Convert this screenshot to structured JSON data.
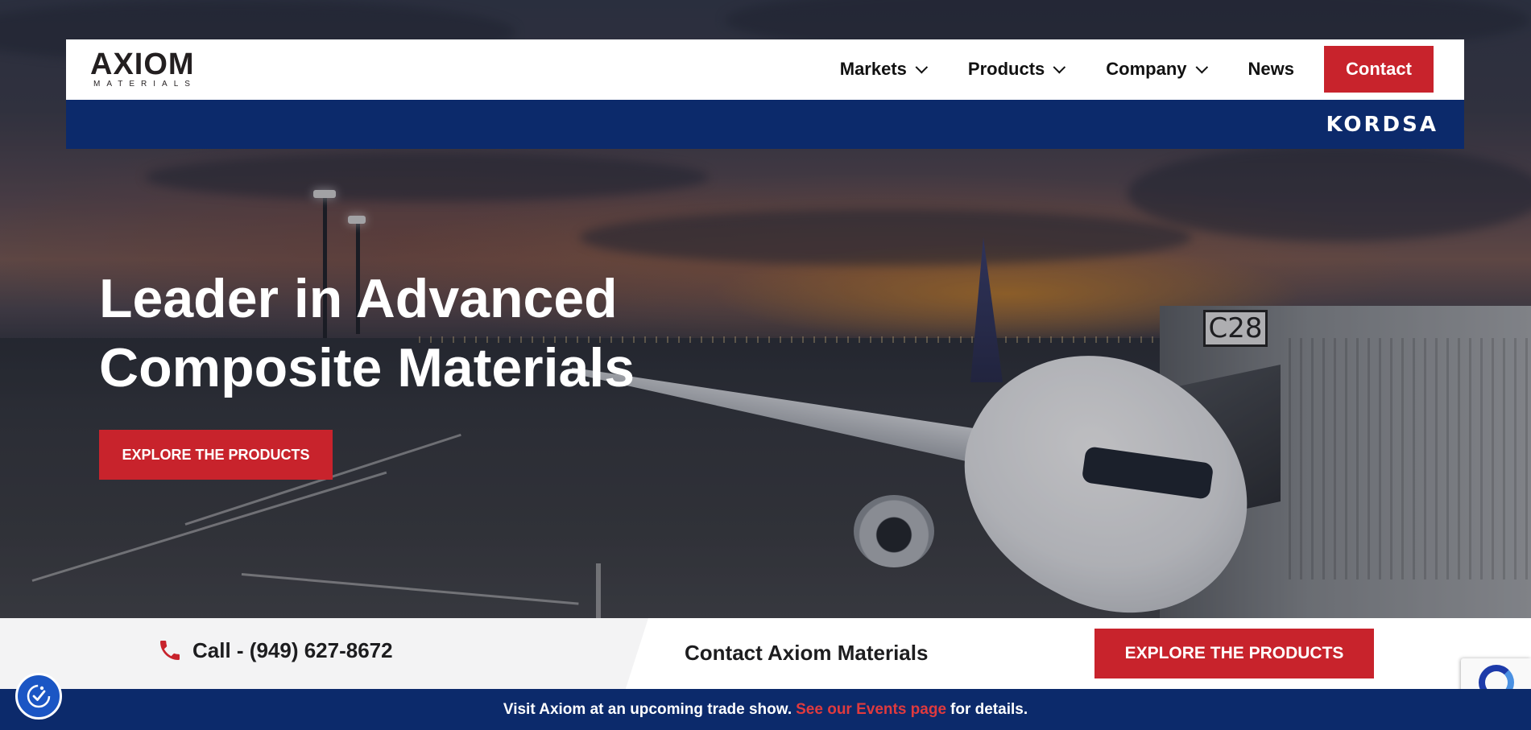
{
  "header": {
    "logo_text": "AXIOM",
    "logo_subtext": "MATERIALS",
    "nav": [
      {
        "label": "Markets",
        "has_dropdown": true
      },
      {
        "label": "Products",
        "has_dropdown": true
      },
      {
        "label": "Company",
        "has_dropdown": true
      },
      {
        "label": "News",
        "has_dropdown": false
      }
    ],
    "contact_label": "Contact",
    "partner_logo": "KORDSA"
  },
  "hero": {
    "title_line1": "Leader in Advanced",
    "title_line2": "Composite Materials",
    "cta_label": "EXPLORE THE PRODUCTS",
    "gate_sign": "C28"
  },
  "strip": {
    "phone_label": "Call - (949) 627-8672",
    "contact_label": "Contact Axiom Materials",
    "cta_label": "EXPLORE THE PRODUCTS"
  },
  "announcement": {
    "prefix": "Visit Axiom at an upcoming trade show.",
    "link": "See our Events page",
    "suffix": "for details."
  },
  "colors": {
    "brand_red": "#c8232c",
    "brand_navy": "#0c2a6b",
    "link_red": "#e03a3e"
  },
  "icons": {
    "phone": "phone-icon",
    "accessibility": "accessibility-icon",
    "recaptcha": "recaptcha-icon",
    "chevron": "chevron-down-icon"
  }
}
